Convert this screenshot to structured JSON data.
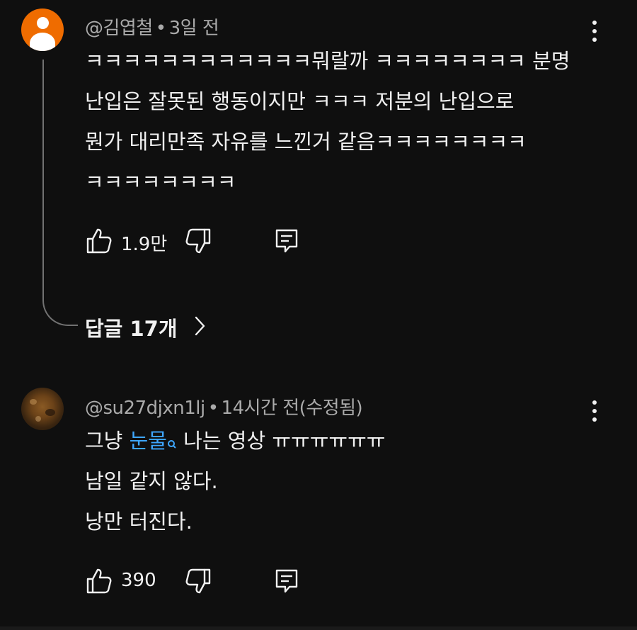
{
  "comments": [
    {
      "author": "@김엽철",
      "dot": "•",
      "time": "3일 전",
      "lines": [
        "ㅋㅋㅋㅋㅋㅋㅋㅋㅋㅋㅋㅋ뭐랄까 ㅋㅋㅋㅋㅋㅋㅋㅋ 분명",
        "난입은 잘못된 행동이지만 ㅋㅋㅋ 저분의 난입으로",
        "뭔가 대리만족 자유를 느낀거 같음ㅋㅋㅋㅋㅋㅋㅋㅋ",
        "ㅋㅋㅋㅋㅋㅋㅋㅋ"
      ],
      "likes": "1.9만",
      "replies_label": "답글 17개"
    },
    {
      "author": "@su27djxn1lj",
      "dot": "•",
      "time": "14시간 전(수정됨)",
      "line1_pre": "그냥 ",
      "line1_link": "눈물",
      "line1_post": " 나는 영상 ㅠㅠㅠㅠㅠㅠ",
      "lines": [
        "남일 같지 않다.",
        "낭만 터진다."
      ],
      "likes": "390"
    }
  ],
  "icons": {
    "like": "thumbs-up-outline",
    "dislike": "thumbs-down-outline",
    "reply": "comment-reply",
    "more": "vertical-ellipsis",
    "chevron": "chevron-right",
    "search": "search-magnifier"
  },
  "colors": {
    "background": "#0f0f0f",
    "text": "#f1f1f1",
    "meta": "#aaaaaa",
    "link": "#3ea6ff",
    "default_avatar": "#ef6c00"
  }
}
